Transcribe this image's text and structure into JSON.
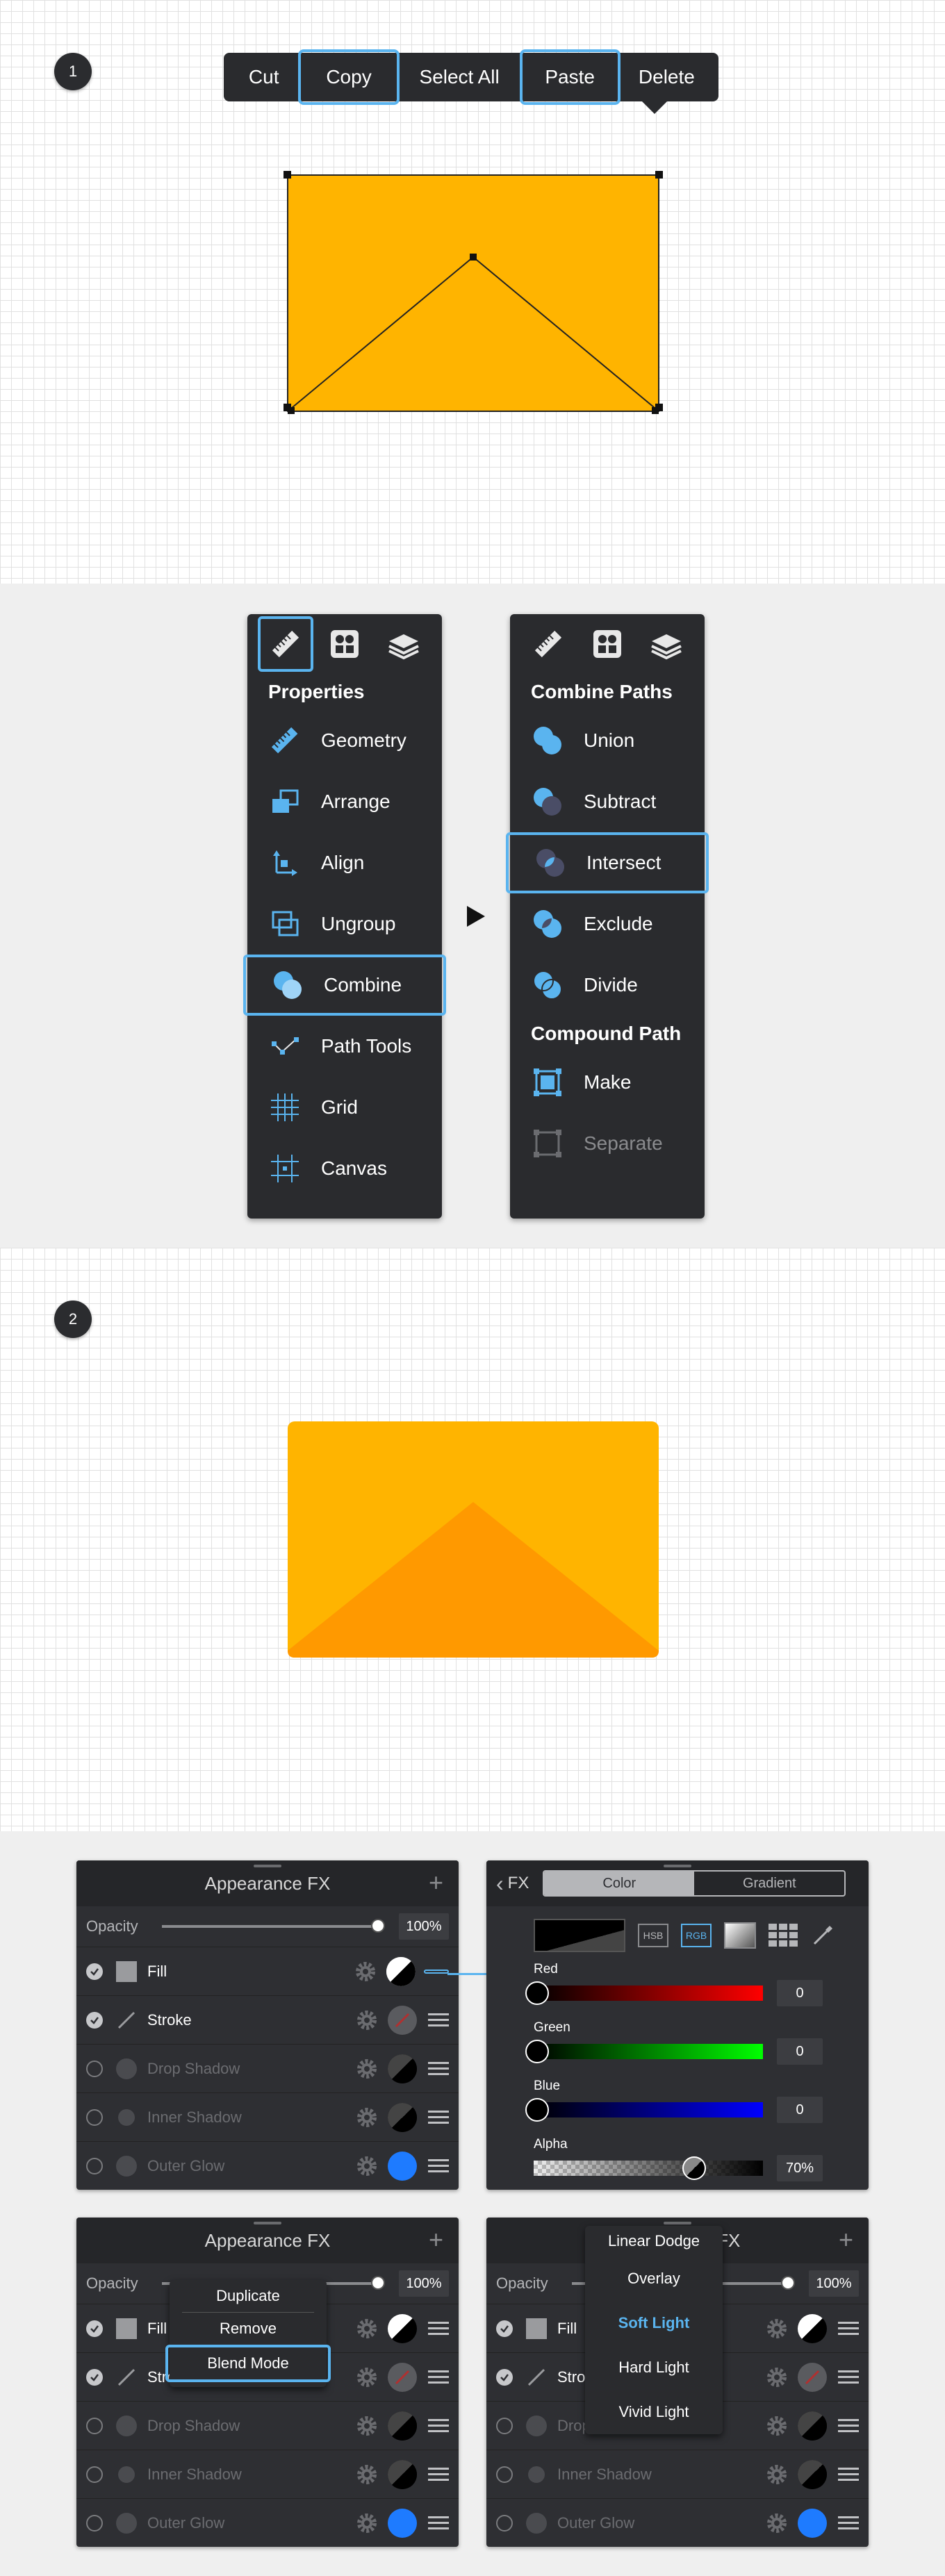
{
  "steps": {
    "one": "1",
    "two": "2"
  },
  "context_menu": {
    "items": [
      {
        "label": "Cut"
      },
      {
        "label": "Copy"
      },
      {
        "label": "Select All"
      },
      {
        "label": "Paste"
      },
      {
        "label": "Delete"
      }
    ]
  },
  "colors": {
    "accent": "#5ab4ef",
    "envelope": "#ffb400",
    "envelope_flap": "#ff9900",
    "panel": "#2a2b2e",
    "blue_swatch": "#1e7bff"
  },
  "properties_panel": {
    "title": "Properties",
    "items": [
      {
        "label": "Geometry",
        "icon": "ruler-icon"
      },
      {
        "label": "Arrange",
        "icon": "arrange-icon"
      },
      {
        "label": "Align",
        "icon": "align-icon"
      },
      {
        "label": "Ungroup",
        "icon": "ungroup-icon"
      },
      {
        "label": "Combine",
        "icon": "combine-icon"
      },
      {
        "label": "Path Tools",
        "icon": "path-tools-icon"
      },
      {
        "label": "Grid",
        "icon": "grid-icon"
      },
      {
        "label": "Canvas",
        "icon": "canvas-icon"
      }
    ]
  },
  "combine_panel": {
    "title": "Combine Paths",
    "items": [
      {
        "label": "Union"
      },
      {
        "label": "Subtract"
      },
      {
        "label": "Intersect"
      },
      {
        "label": "Exclude"
      },
      {
        "label": "Divide"
      }
    ],
    "compound_title": "Compound Path",
    "compound_items": [
      {
        "label": "Make"
      },
      {
        "label": "Separate"
      }
    ]
  },
  "appearance": {
    "title": "Appearance FX",
    "opacity_label": "Opacity",
    "opacity_value": "100%",
    "rows": [
      {
        "label": "Fill"
      },
      {
        "label": "Stroke"
      },
      {
        "label": "Drop Shadow"
      },
      {
        "label": "Inner Shadow"
      },
      {
        "label": "Outer Glow"
      }
    ]
  },
  "color_panel": {
    "back_label": "FX",
    "tab_color": "Color",
    "tab_gradient": "Gradient",
    "mode_hsb": "HSB",
    "mode_rgb": "RGB",
    "red_label": "Red",
    "red_value": "0",
    "green_label": "Green",
    "green_value": "0",
    "blue_label": "Blue",
    "blue_value": "0",
    "alpha_label": "Alpha",
    "alpha_value": "70%"
  },
  "row_menu": {
    "items": [
      {
        "label": "Duplicate"
      },
      {
        "label": "Remove"
      },
      {
        "label": "Blend Mode"
      }
    ]
  },
  "blend_menu": {
    "items": [
      {
        "label": "Linear Dodge"
      },
      {
        "label": "Overlay"
      },
      {
        "label": "Soft Light"
      },
      {
        "label": "Hard Light"
      },
      {
        "label": "Vivid Light"
      }
    ]
  }
}
